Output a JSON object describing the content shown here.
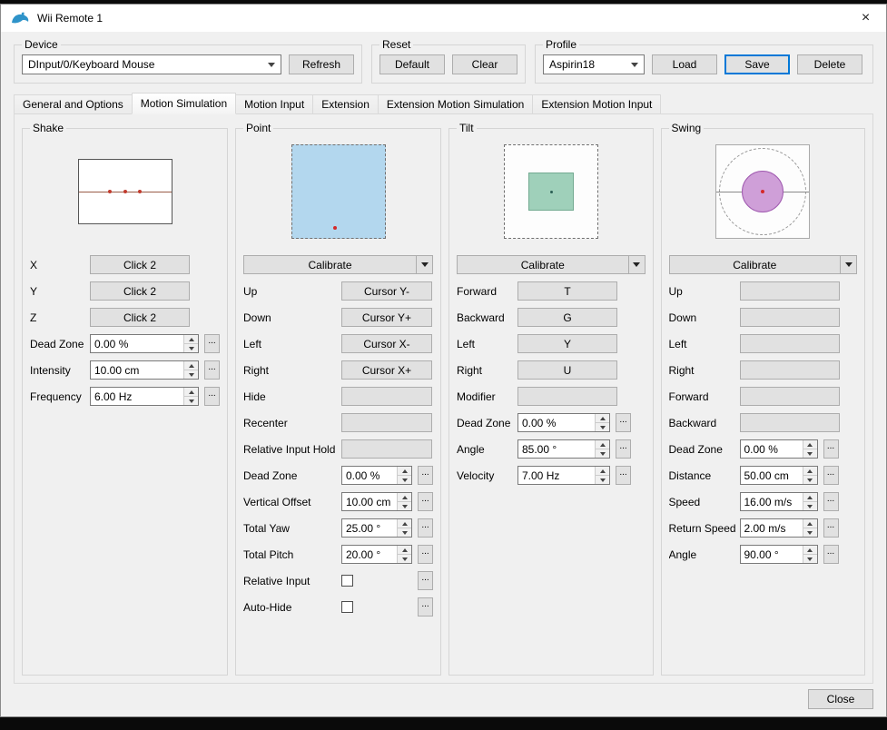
{
  "window": {
    "title": "Wii Remote 1",
    "close_glyph": "×"
  },
  "ui": {
    "dots": "..."
  },
  "device": {
    "label": "Device",
    "value": "DInput/0/Keyboard Mouse",
    "refresh": "Refresh"
  },
  "reset": {
    "label": "Reset",
    "default": "Default",
    "clear": "Clear"
  },
  "profile": {
    "label": "Profile",
    "value": "Aspirin18",
    "load": "Load",
    "save": "Save",
    "delete": "Delete"
  },
  "tabs": [
    {
      "label": "General and Options",
      "selected": false
    },
    {
      "label": "Motion Simulation",
      "selected": true
    },
    {
      "label": "Motion Input",
      "selected": false
    },
    {
      "label": "Extension",
      "selected": false
    },
    {
      "label": "Extension Motion Simulation",
      "selected": false
    },
    {
      "label": "Extension Motion Input",
      "selected": false
    }
  ],
  "shake": {
    "title": "Shake",
    "buttons": [
      {
        "label": "X",
        "value": "Click 2"
      },
      {
        "label": "Y",
        "value": "Click 2"
      },
      {
        "label": "Z",
        "value": "Click 2"
      }
    ],
    "spins": [
      {
        "label": "Dead Zone",
        "value": "0.00 %"
      },
      {
        "label": "Intensity",
        "value": "10.00 cm"
      },
      {
        "label": "Frequency",
        "value": "6.00 Hz"
      }
    ]
  },
  "point": {
    "title": "Point",
    "calibrate": "Calibrate",
    "buttons": [
      {
        "label": "Up",
        "value": "Cursor Y-"
      },
      {
        "label": "Down",
        "value": "Cursor Y+"
      },
      {
        "label": "Left",
        "value": "Cursor X-"
      },
      {
        "label": "Right",
        "value": "Cursor X+"
      },
      {
        "label": "Hide",
        "value": ""
      },
      {
        "label": "Recenter",
        "value": ""
      },
      {
        "label": "Relative Input Hold",
        "value": ""
      }
    ],
    "spins": [
      {
        "label": "Dead Zone",
        "value": "0.00 %"
      },
      {
        "label": "Vertical Offset",
        "value": "10.00 cm"
      },
      {
        "label": "Total Yaw",
        "value": "25.00 °"
      },
      {
        "label": "Total Pitch",
        "value": "20.00 °"
      }
    ],
    "checks": [
      {
        "label": "Relative Input",
        "checked": false
      },
      {
        "label": "Auto-Hide",
        "checked": false
      }
    ]
  },
  "tilt": {
    "title": "Tilt",
    "calibrate": "Calibrate",
    "buttons": [
      {
        "label": "Forward",
        "value": "T"
      },
      {
        "label": "Backward",
        "value": "G"
      },
      {
        "label": "Left",
        "value": "Y"
      },
      {
        "label": "Right",
        "value": "U"
      },
      {
        "label": "Modifier",
        "value": ""
      }
    ],
    "spins": [
      {
        "label": "Dead Zone",
        "value": "0.00 %"
      },
      {
        "label": "Angle",
        "value": "85.00 °"
      },
      {
        "label": "Velocity",
        "value": "7.00 Hz"
      }
    ]
  },
  "swing": {
    "title": "Swing",
    "calibrate": "Calibrate",
    "buttons": [
      {
        "label": "Up",
        "value": ""
      },
      {
        "label": "Down",
        "value": ""
      },
      {
        "label": "Left",
        "value": ""
      },
      {
        "label": "Right",
        "value": ""
      },
      {
        "label": "Forward",
        "value": ""
      },
      {
        "label": "Backward",
        "value": ""
      }
    ],
    "spins": [
      {
        "label": "Dead Zone",
        "value": "0.00 %"
      },
      {
        "label": "Distance",
        "value": "50.00 cm"
      },
      {
        "label": "Speed",
        "value": "16.00 m/s"
      },
      {
        "label": "Return Speed",
        "value": "2.00 m/s"
      },
      {
        "label": "Angle",
        "value": "90.00 °"
      }
    ]
  },
  "footer": {
    "close": "Close"
  },
  "colors": {
    "accent": "#0078d7",
    "point_fill": "#b3d7ee",
    "tilt_fill": "#9fd0ba",
    "swing_fill": "#cf9fd8",
    "marker_red": "#d42a2a"
  }
}
